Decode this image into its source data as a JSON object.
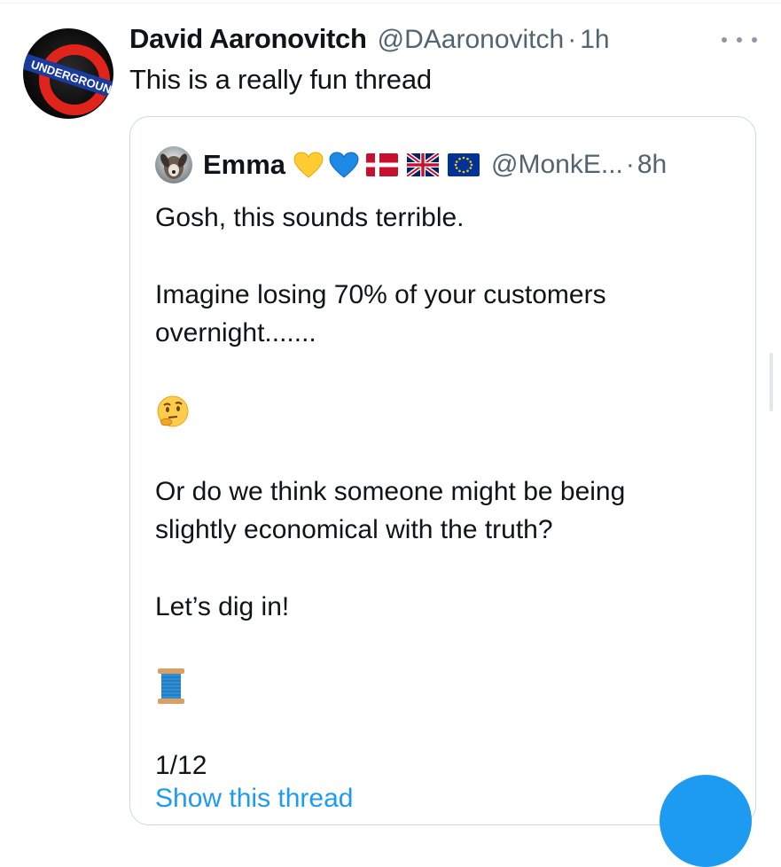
{
  "tweet": {
    "display_name": "David Aaronovitch",
    "handle": "@DAaronovitch",
    "separator": "·",
    "time": "1h",
    "text": "This is a really fun thread",
    "avatar_text": "UNDERGROUND"
  },
  "quote": {
    "display_name": "Emma",
    "handle": "@MonkE...",
    "separator": "·",
    "time": "8h",
    "lines": [
      "Gosh, this sounds terrible.",
      "Imagine losing 70% of your customers",
      "overnight.......",
      "Or do we think someone might be being",
      "slightly economical with the truth?",
      "Let’s dig in!",
      "1/12"
    ],
    "link_partial": "Show this thread"
  },
  "icons": {
    "more": "more-horizontal-icon",
    "yellow_heart": "yellow-heart-emoji",
    "blue_heart": "blue-heart-emoji",
    "flags": [
      "denmark-flag",
      "uk-flag",
      "eu-flag"
    ],
    "thinking": "thinking-face-emoji",
    "thread": "spool-of-thread-emoji"
  },
  "colors": {
    "text": "#0f1419",
    "secondary": "#536471",
    "border": "#cfd9de",
    "accent": "#1d9bf0"
  }
}
